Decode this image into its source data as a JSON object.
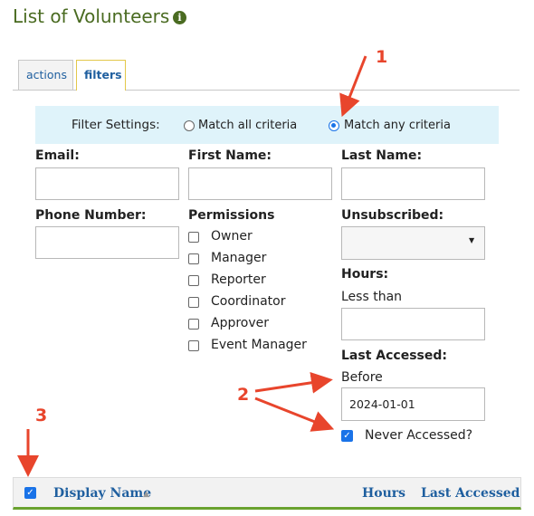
{
  "page": {
    "title": "List of Volunteers",
    "info_icon": "i"
  },
  "tabs": [
    {
      "label": "actions",
      "active": false
    },
    {
      "label": "filters",
      "active": true
    }
  ],
  "filter_settings": {
    "label": "Filter Settings:",
    "options": [
      {
        "label": "Match all criteria",
        "selected": false
      },
      {
        "label": "Match any criteria",
        "selected": true
      }
    ]
  },
  "fields": {
    "email": {
      "label": "Email:",
      "value": ""
    },
    "first_name": {
      "label": "First Name:",
      "value": ""
    },
    "last_name": {
      "label": "Last Name:",
      "value": ""
    },
    "phone": {
      "label": "Phone Number:",
      "value": ""
    },
    "unsubscribed": {
      "label": "Unsubscribed:",
      "value": ""
    },
    "hours": {
      "label": "Hours:",
      "sublabel": "Less than",
      "value": ""
    },
    "last_accessed": {
      "label": "Last Accessed:",
      "sublabel": "Before",
      "value": "2024-01-01"
    },
    "never_accessed": {
      "label": "Never Accessed?",
      "checked": true
    }
  },
  "permissions": {
    "label": "Permissions",
    "items": [
      "Owner",
      "Manager",
      "Reporter",
      "Coordinator",
      "Approver",
      "Event Manager"
    ]
  },
  "table": {
    "select_all_checked": true,
    "columns": [
      "Display Name",
      "Hours",
      "Last Accessed"
    ],
    "sort_indicator": "▲"
  },
  "annotations": [
    "1",
    "2",
    "3"
  ],
  "colors": {
    "title": "#4a6b21",
    "link": "#1f5f9f",
    "filter_bar": "#dff3fa",
    "annotation": "#e8452c",
    "header_border": "#6aa22f"
  }
}
